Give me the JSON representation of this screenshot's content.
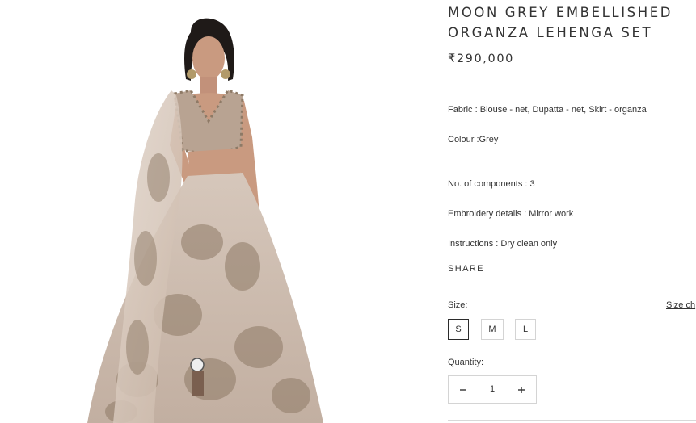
{
  "product": {
    "title_line1": "MOON GREY EMBELLISHED",
    "title_line2": "ORGANZA LEHENGA SET",
    "price": "₹290,000",
    "image_alt": "Model wearing moon grey embellished organza lehenga set"
  },
  "details": [
    "Fabric : Blouse - net, Dupatta - net, Skirt - organza",
    "Colour :Grey",
    "No. of components : 3",
    "Embroidery details : Mirror work",
    "Instructions : Dry clean only"
  ],
  "share_label": "SHARE",
  "size": {
    "label": "Size:",
    "chart_link": "Size ch",
    "options": [
      "S",
      "M",
      "L"
    ],
    "selected": "S"
  },
  "quantity": {
    "label": "Quantity:",
    "value": "1"
  },
  "colors": {
    "text": "#333333",
    "outfit": "#c9b6a8",
    "embellishment": "#8e7a66"
  }
}
